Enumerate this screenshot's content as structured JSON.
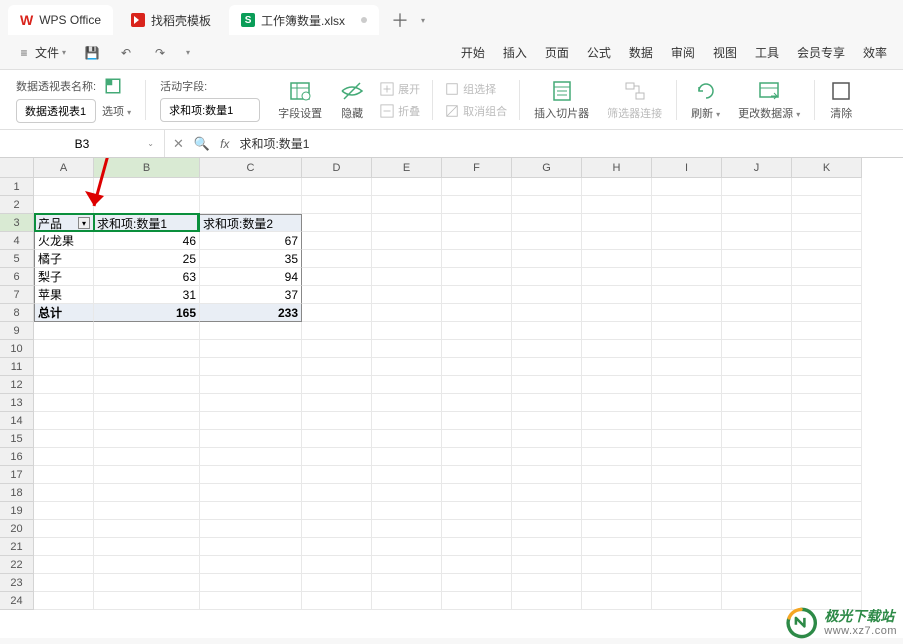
{
  "tabs": {
    "app": "WPS Office",
    "template": "找稻壳模板",
    "doc": "工作簿数量.xlsx",
    "doc_icon": "S"
  },
  "menu": {
    "file": "文件",
    "items": [
      "开始",
      "插入",
      "页面",
      "公式",
      "数据",
      "审阅",
      "视图",
      "工具",
      "会员专享",
      "效率"
    ]
  },
  "ribbon": {
    "pivot_name_label": "数据透视表名称:",
    "pivot_name": "数据透视表1",
    "options": "选项",
    "active_field_label": "活动字段:",
    "active_field": "求和项:数量1",
    "field_settings": "字段设置",
    "hide": "隐藏",
    "expand": "展开",
    "collapse": "折叠",
    "group_select": "组选择",
    "ungroup": "取消组合",
    "insert_slicer": "插入切片器",
    "filter_conn": "筛选器连接",
    "refresh": "刷新",
    "change_source": "更改数据源",
    "clear": "清除"
  },
  "formula": {
    "cellref": "B3",
    "value": "求和项:数量1"
  },
  "columns": [
    "A",
    "B",
    "C",
    "D",
    "E",
    "F",
    "G",
    "H",
    "I",
    "J",
    "K"
  ],
  "table": {
    "headers": {
      "a": "产品",
      "b": "求和项:数量1",
      "c": "求和项:数量2"
    },
    "rows": [
      {
        "a": "火龙果",
        "b": "46",
        "c": "67"
      },
      {
        "a": "橘子",
        "b": "25",
        "c": "35"
      },
      {
        "a": "梨子",
        "b": "63",
        "c": "94"
      },
      {
        "a": "苹果",
        "b": "31",
        "c": "37"
      }
    ],
    "total": {
      "a": "总计",
      "b": "165",
      "c": "233"
    }
  },
  "watermark": {
    "cn": "极光下载站",
    "en": "www.xz7.com"
  },
  "chart_data": {
    "type": "table",
    "title": "数据透视表",
    "columns": [
      "产品",
      "求和项:数量1",
      "求和项:数量2"
    ],
    "rows": [
      [
        "火龙果",
        46,
        67
      ],
      [
        "橘子",
        25,
        35
      ],
      [
        "梨子",
        63,
        94
      ],
      [
        "苹果",
        31,
        37
      ]
    ],
    "totals": [
      "总计",
      165,
      233
    ]
  }
}
